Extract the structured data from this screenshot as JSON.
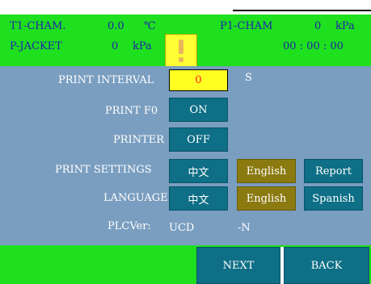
{
  "top_fragment": "",
  "header": {
    "t1_label": "T1-CHAM.",
    "t1_value": "0.0",
    "t1_unit": "℃",
    "jacket_label": "P-JACKET",
    "jacket_value": "0",
    "jacket_unit": "kPa",
    "p1_label": "P1-CHAM",
    "p1_value": "0",
    "p1_unit": "kPa",
    "time": "00 : 00 : 00",
    "warning_icon": "exclamation-icon"
  },
  "settings": {
    "print_interval_label": "PRINT INTERVAL",
    "print_interval_value": "0",
    "print_interval_unit": "S",
    "print_f0_label": "PRINT F0",
    "print_f0_value": "ON",
    "printer_label": "PRINTER",
    "printer_value": "OFF",
    "print_settings_label": "PRINT SETTINGS",
    "print_settings_options": [
      "中文",
      "English",
      "Report"
    ],
    "language_label": "LANGUAGE",
    "language_options": [
      "中文",
      "English",
      "Spanish"
    ],
    "plc_label": "PLCVer:",
    "plc_value": "UCD",
    "plc_suffix": "-N"
  },
  "footer": {
    "next_label": "NEXT",
    "back_label": "BACK"
  },
  "colors": {
    "header_green": "#1ee01e",
    "panel_blue": "#7a9ec0",
    "button_teal": "#0e6f86",
    "button_olive": "#8a7a10",
    "input_yellow": "#ffff22",
    "input_text_red": "#ff2222"
  }
}
